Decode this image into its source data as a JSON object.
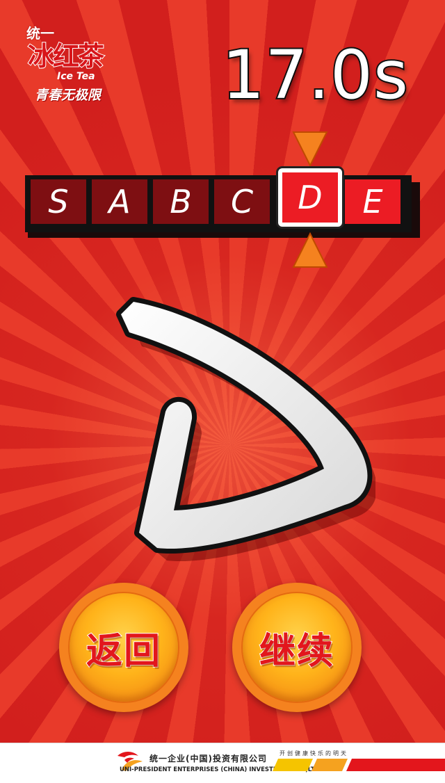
{
  "logo": {
    "tongyi": "统一",
    "brand": "冰红茶",
    "sub": "Ice Tea",
    "slogan": "青春无极限"
  },
  "timer": {
    "text": "17.0s"
  },
  "letter_strip": {
    "tiles": [
      {
        "char": "S",
        "style": "dark"
      },
      {
        "char": "A",
        "style": "dark"
      },
      {
        "char": "B",
        "style": "dark"
      },
      {
        "char": "C",
        "style": "dark"
      },
      {
        "char": "D",
        "style": "selected"
      },
      {
        "char": "E",
        "style": "bright"
      }
    ],
    "current_letter": "D",
    "colors": {
      "dark": "#7e0f12",
      "bright": "#ec1c24",
      "arrow": "#f5821f"
    }
  },
  "buttons": {
    "back_label": "返回",
    "continue_label": "继续"
  },
  "footer": {
    "company_cn": "统一企业(中国)投资有限公司",
    "company_en": "UNI-PRESIDENT ENTERPRISES (CHINA) INVESTMENT CO.,LTD.",
    "tagline": "开创健康快乐的明天"
  },
  "colors": {
    "background": "#d21f1d",
    "button_outer": "#f5821f",
    "button_text": "#e3161c"
  }
}
